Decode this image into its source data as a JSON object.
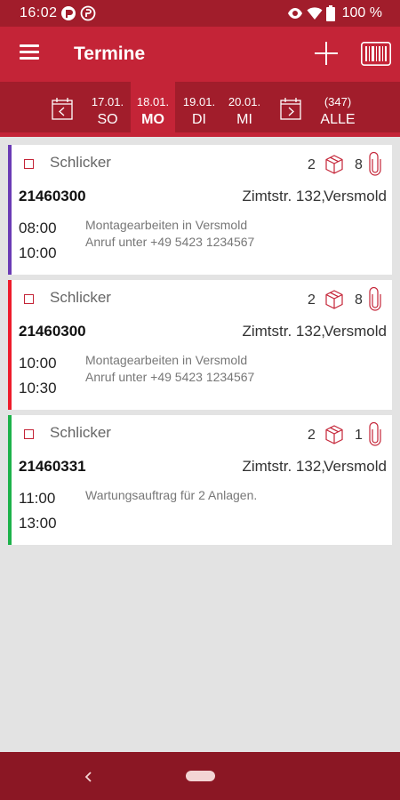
{
  "status_bar": {
    "time": "16:02",
    "battery": "100 %"
  },
  "app_bar": {
    "title": "Termine"
  },
  "date_nav": {
    "days": [
      {
        "date": "17.01.",
        "day": "SO",
        "active": false
      },
      {
        "date": "18.01.",
        "day": "MO",
        "active": true
      },
      {
        "date": "19.01.",
        "day": "DI",
        "active": false
      },
      {
        "date": "20.01.",
        "day": "MI",
        "active": false
      }
    ],
    "all": {
      "count": "(347)",
      "label": "ALLE"
    }
  },
  "colors": {
    "primary": "#c42437",
    "primary_dark": "#a11d2b",
    "nav": "#8b1724"
  },
  "appointments": [
    {
      "customer": "Schlicker",
      "packages": "2",
      "attachments": "8",
      "order_no": "21460300",
      "street": "Zimtstr. 132,",
      "city": "Versmold",
      "time_start": "08:00",
      "time_end": "10:00",
      "desc_line1": "Montagearbeiten in Versmold",
      "desc_line2": "Anruf unter +49 5423 1234567",
      "color": "#6a3bb5"
    },
    {
      "customer": "Schlicker",
      "packages": "2",
      "attachments": "8",
      "order_no": "21460300",
      "street": "Zimtstr. 132,",
      "city": "Versmold",
      "time_start": "10:00",
      "time_end": "10:30",
      "desc_line1": "Montagearbeiten in Versmold",
      "desc_line2": "Anruf unter +49 5423 1234567",
      "color": "#ee1c2b"
    },
    {
      "customer": "Schlicker",
      "packages": "2",
      "attachments": "1",
      "order_no": "21460331",
      "street": "Zimtstr. 132,",
      "city": "Versmold",
      "time_start": "11:00",
      "time_end": "13:00",
      "desc_line1": "Wartungsauftrag für 2 Anlagen.",
      "desc_line2": "",
      "color": "#1db24a"
    }
  ]
}
